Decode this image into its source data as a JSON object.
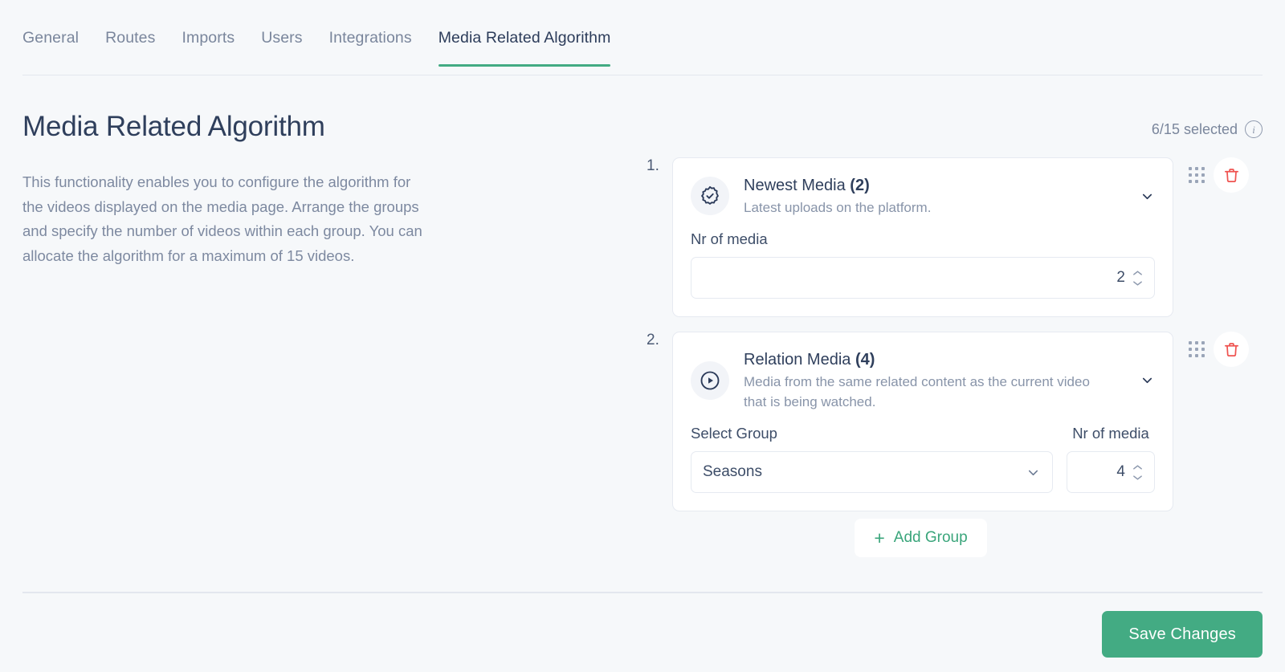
{
  "tabs": [
    {
      "label": "General",
      "active": false
    },
    {
      "label": "Routes",
      "active": false
    },
    {
      "label": "Imports",
      "active": false
    },
    {
      "label": "Users",
      "active": false
    },
    {
      "label": "Integrations",
      "active": false
    },
    {
      "label": "Media Related Algorithm",
      "active": true
    }
  ],
  "header": {
    "title": "Media Related Algorithm",
    "selected_text": "6/15 selected",
    "info_icon": "info-icon"
  },
  "description": "This functionality enables you to configure the algorithm for the videos displayed on the media page. Arrange the groups and specify the number of videos within each group. You can allocate the algorithm for a maximum of 15 videos.",
  "groups": [
    {
      "index": "1.",
      "icon": "verified-badge-icon",
      "title": "Newest Media",
      "count": "(2)",
      "subtitle": "Latest uploads on the platform.",
      "chevron_icon": "chevron-down-icon",
      "drag_icon": "drag-handle-icon",
      "delete_icon": "trash-icon",
      "nr_label": "Nr of media",
      "nr_value": "2"
    },
    {
      "index": "2.",
      "icon": "play-circle-icon",
      "title": "Relation Media",
      "count": "(4)",
      "subtitle": "Media from the same related content as the current video that is being watched.",
      "chevron_icon": "chevron-down-icon",
      "drag_icon": "drag-handle-icon",
      "delete_icon": "trash-icon",
      "select_label": "Select Group",
      "select_value": "Seasons",
      "select_chevron_icon": "chevron-down-icon",
      "nr_label": "Nr of media",
      "nr_value": "4"
    }
  ],
  "add_group": {
    "label": "Add Group",
    "plus": "+",
    "icon": "plus-icon"
  },
  "footer": {
    "save_label": "Save Changes"
  },
  "colors": {
    "accent_green": "#43ab83",
    "add_green": "#3aa57b",
    "delete_red": "#ef5350",
    "text_dark": "#2f3f5c",
    "text_muted": "#7d89a0",
    "page_bg": "#f6f8fa",
    "card_border": "#e6eaf1"
  }
}
